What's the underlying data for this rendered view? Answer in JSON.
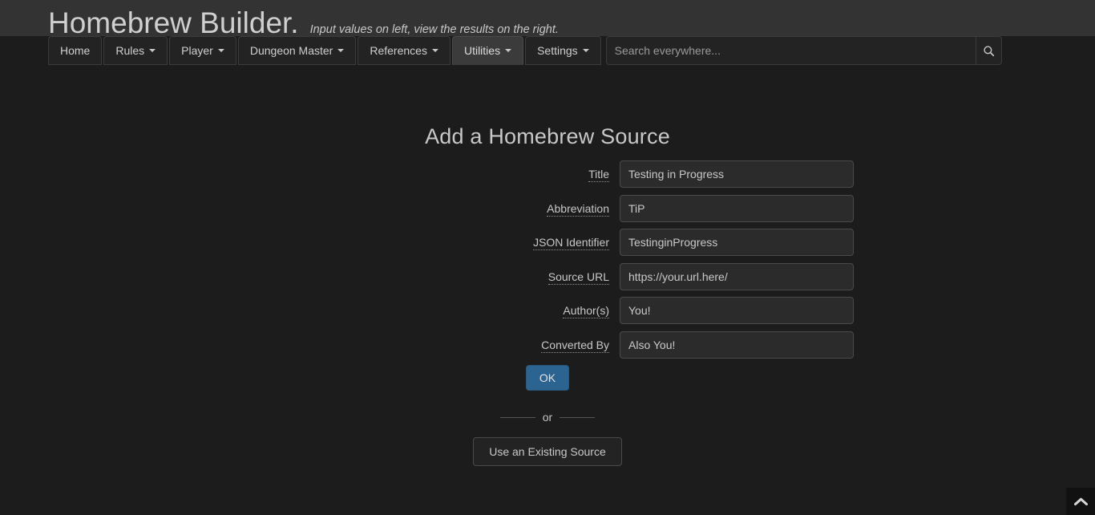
{
  "header": {
    "brand_title": "Homebrew Builder.",
    "tagline": "Input values on left, view the results on the right."
  },
  "nav": {
    "items": [
      {
        "label": "Home",
        "has_caret": false,
        "active": false
      },
      {
        "label": "Rules",
        "has_caret": true,
        "active": false
      },
      {
        "label": "Player",
        "has_caret": true,
        "active": false
      },
      {
        "label": "Dungeon Master",
        "has_caret": true,
        "active": false
      },
      {
        "label": "References",
        "has_caret": true,
        "active": false
      },
      {
        "label": "Utilities",
        "has_caret": true,
        "active": true
      },
      {
        "label": "Settings",
        "has_caret": true,
        "active": false
      }
    ]
  },
  "search": {
    "placeholder": "Search everywhere...",
    "value": "",
    "icon": "search-icon"
  },
  "main": {
    "page_title": "Add a Homebrew Source",
    "fields": [
      {
        "label": "Title",
        "value": "Testing in Progress"
      },
      {
        "label": "Abbreviation",
        "value": "TiP"
      },
      {
        "label": "JSON Identifier",
        "value": "TestinginProgress"
      },
      {
        "label": "Source URL",
        "value": "https://your.url.here/"
      },
      {
        "label": "Author(s)",
        "value": "You!"
      },
      {
        "label": "Converted By",
        "value": "Also You!"
      }
    ],
    "ok_label": "OK",
    "or_label": "or",
    "existing_label": "Use an Existing Source"
  },
  "footer": {
    "back_to_top_icon": "chevron-up-icon"
  },
  "colors": {
    "page_background": "#1c1c1c",
    "header_background": "#333333",
    "primary_button": "#2b6391",
    "text": "#c8c8c8",
    "border": "#4a4a4a",
    "active_tab": "#3b3b3b"
  }
}
